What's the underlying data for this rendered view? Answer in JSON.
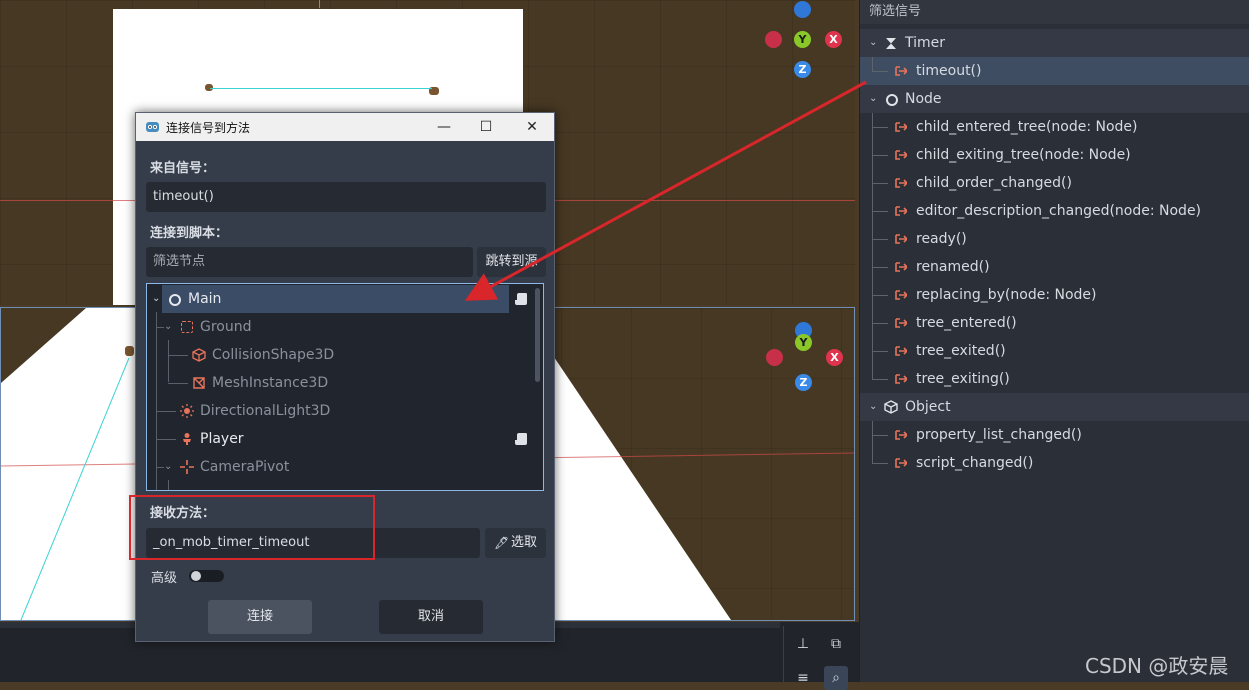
{
  "dialog": {
    "title": "连接信号到方法",
    "from_signal_label": "来自信号：",
    "from_signal_value": "timeout()",
    "connect_to_script_label": "连接到脚本：",
    "filter_placeholder": "筛选节点",
    "goto_source_button": "跳转到源",
    "tree": [
      {
        "label": "Main",
        "icon": "circle-node-icon",
        "style": "selected",
        "script": true
      },
      {
        "label": "Ground",
        "icon": "static-body-icon",
        "style": "muted"
      },
      {
        "label": "CollisionShape3D",
        "icon": "collision-shape-icon",
        "style": "muted"
      },
      {
        "label": "MeshInstance3D",
        "icon": "mesh-instance-icon",
        "style": "muted"
      },
      {
        "label": "DirectionalLight3D",
        "icon": "light-icon",
        "style": "muted"
      },
      {
        "label": "Player",
        "icon": "character-icon",
        "style": "bright",
        "script": true
      },
      {
        "label": "CameraPivot",
        "icon": "marker-icon",
        "style": "muted"
      }
    ],
    "receiver_method_label": "接收方法：",
    "receiver_method_value": "_on_mob_timer_timeout",
    "pick_button": "选取",
    "advanced_label": "高级",
    "advanced_on": false,
    "connect_button": "连接",
    "cancel_button": "取消"
  },
  "signals_panel": {
    "filter_label": "筛选信号",
    "categories": [
      {
        "name": "Timer",
        "icon": "hourglass-icon",
        "signals": [
          "timeout()"
        ]
      },
      {
        "name": "Node",
        "icon": "circle-node-icon",
        "signals": [
          "child_entered_tree(node: Node)",
          "child_exiting_tree(node: Node)",
          "child_order_changed()",
          "editor_description_changed(node: Node)",
          "ready()",
          "renamed()",
          "replacing_by(node: Node)",
          "tree_entered()",
          "tree_exited()",
          "tree_exiting()"
        ]
      },
      {
        "name": "Object",
        "icon": "cube-icon",
        "signals": [
          "property_list_changed()",
          "script_changed()"
        ]
      }
    ],
    "selected_signal": "timeout()"
  },
  "gizmo": {
    "y": "Y",
    "x": "X",
    "z": "Z"
  },
  "watermark": "CSDN @政安晨",
  "colors": {
    "annotation_red": "#d8262b",
    "signal_icon": "#e8735a",
    "selection": "#3f4d63"
  }
}
